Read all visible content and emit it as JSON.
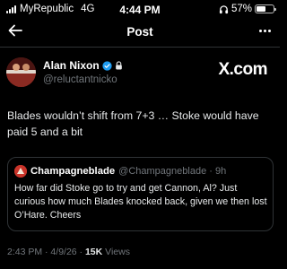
{
  "status_bar": {
    "carrier": "MyRepublic",
    "network": "4G",
    "time": "4:44 PM",
    "battery": "57%",
    "battery_level": 0.57
  },
  "nav": {
    "title": "Post",
    "back_icon": "arrow-left-icon",
    "more_icon": "more-horizontal-icon"
  },
  "post": {
    "author_name": "Alan Nixon",
    "author_handle": "@reluctantnicko",
    "source_label": "X.com",
    "text": "Blades wouldn’t shift from 7+3 … Stoke would have paid 5 and a bit",
    "quote": {
      "author_name": "Champagneblade",
      "author_handle": "@Champagneblade · 9h",
      "text": "How far did Stoke go to try and get Cannon, Al? Just curious how much Blades knocked back, given we then lost O’Hare. Cheers"
    },
    "meta": {
      "datetime": "2:43 PM · 4/9/26 · ",
      "views_count": "15K",
      "views_label": " Views"
    }
  },
  "colors": {
    "background": "#000000",
    "text_primary": "#e7e9ea",
    "text_secondary": "#71767b",
    "border": "#2f3336",
    "verified_blue": "#1d9bf0"
  }
}
